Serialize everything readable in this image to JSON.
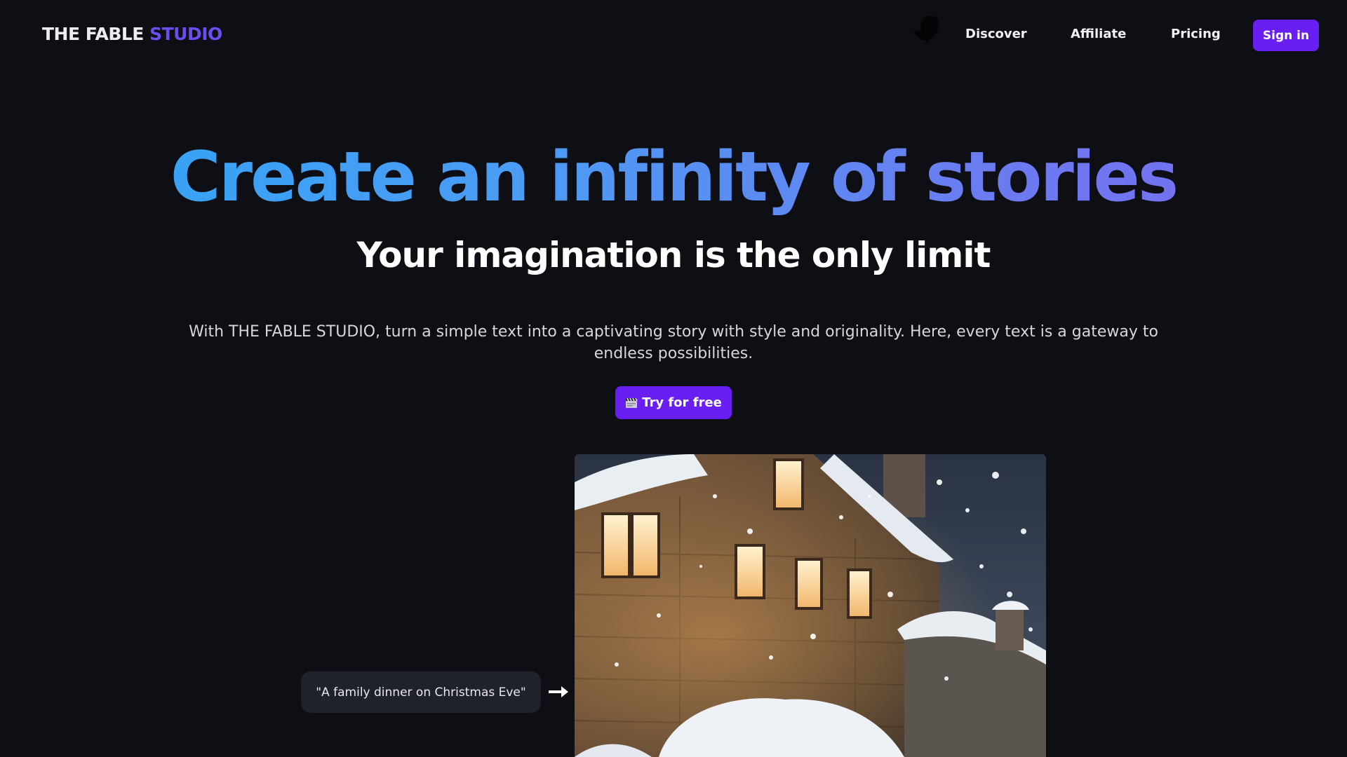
{
  "nav": {
    "logo_part1": "THE FABLE",
    "logo_part2": "STUDIO",
    "links": [
      "Discover",
      "Affiliate",
      "Pricing"
    ],
    "signin_label": "Sign in"
  },
  "hero": {
    "headline": "Create an infinity of stories",
    "subheadline": "Your imagination is the only limit",
    "description": "With THE FABLE STUDIO, turn a simple text into a captivating story with style and originality. Here, every text is a gateway to endless possibilities.",
    "cta_label": "Try for free"
  },
  "demo": {
    "prompt": "\"A family dinner on Christmas Eve\""
  },
  "colors": {
    "background": "#0e0f15",
    "accent": "#6a1ff2",
    "logo_accent": "#6d4cf0",
    "headline_gradient_start": "#2fa6f6",
    "headline_gradient_end": "#7a6af0"
  },
  "icons": {
    "mascot": "mascot-icon",
    "cta": "clapperboard-icon",
    "arrow": "arrow-right-icon"
  }
}
